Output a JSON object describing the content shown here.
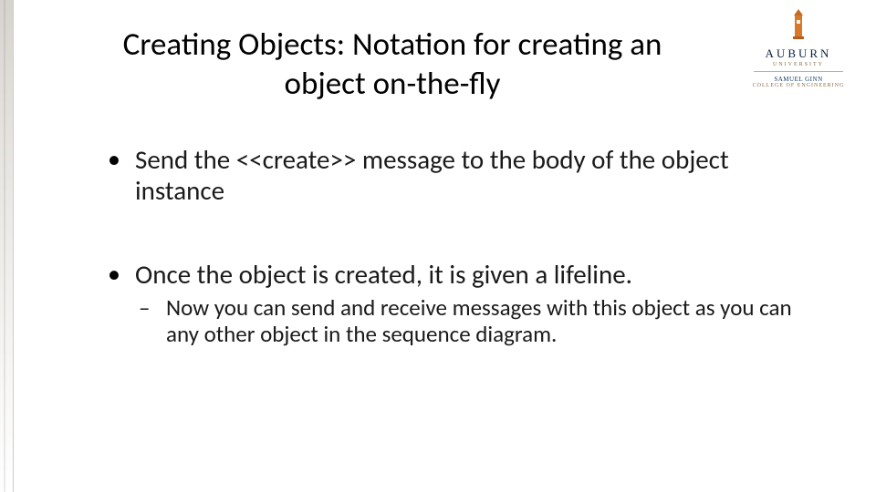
{
  "title": "Creating Objects: Notation for creating an object on-the-fly",
  "logo": {
    "word": "AUBURN",
    "sub1": "UNIVERSITY",
    "sub2": "SAMUEL GINN",
    "sub3": "COLLEGE OF ENGINEERING"
  },
  "bullets": [
    {
      "text": "Send the <<create>> message to the body of the object instance",
      "sub": []
    },
    {
      "text": "Once the object is created, it is given a lifeline.",
      "sub": [
        "Now you can send and receive messages with this object as you can any other object in the sequence diagram."
      ]
    }
  ]
}
